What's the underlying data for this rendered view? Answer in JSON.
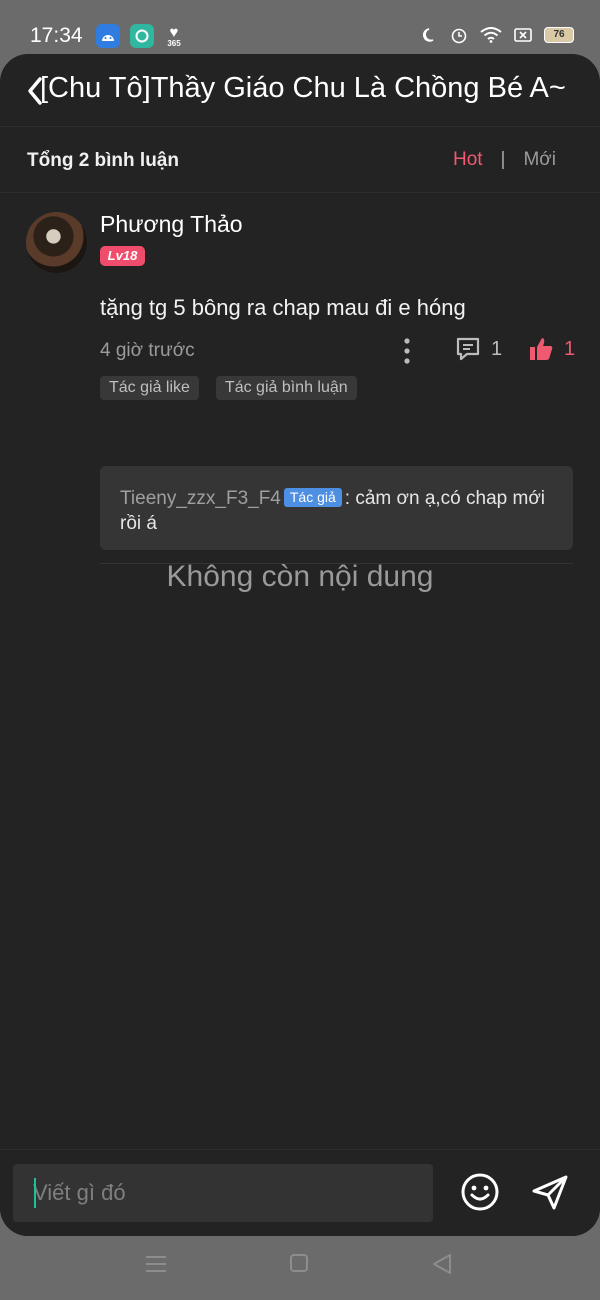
{
  "status_bar": {
    "time": "17:34",
    "badge_365": "365",
    "battery": "76"
  },
  "header": {
    "title": "[Chu Tô]Thầy Giáo Chu Là Chồng Bé A~"
  },
  "subbar": {
    "total": "Tổng 2 bình luận",
    "sort_hot": "Hot",
    "separator": "|",
    "sort_new": "Mới"
  },
  "comment": {
    "username": "Phương Thảo",
    "level": "Lv18",
    "text": "tặng tg 5 bông ra chap mau đi e hóng",
    "time_ago": "4 giờ trước",
    "reply_count": "1",
    "like_count": "1",
    "tags": [
      "Tác giả like",
      "Tác giả bình luận"
    ],
    "reply": {
      "author": "Tieeny_zzx_F3_F4",
      "badge": "Tác giả",
      "text": ": cảm ơn ạ,có chap mới rồi á"
    }
  },
  "empty_text": "Không còn nội dung",
  "composer": {
    "placeholder": "Viết gì đó"
  },
  "colors": {
    "accent": "#ef5a71",
    "background": "#232323",
    "author_badge": "#4d8fe3",
    "level_badge": "#ef4d6b"
  }
}
